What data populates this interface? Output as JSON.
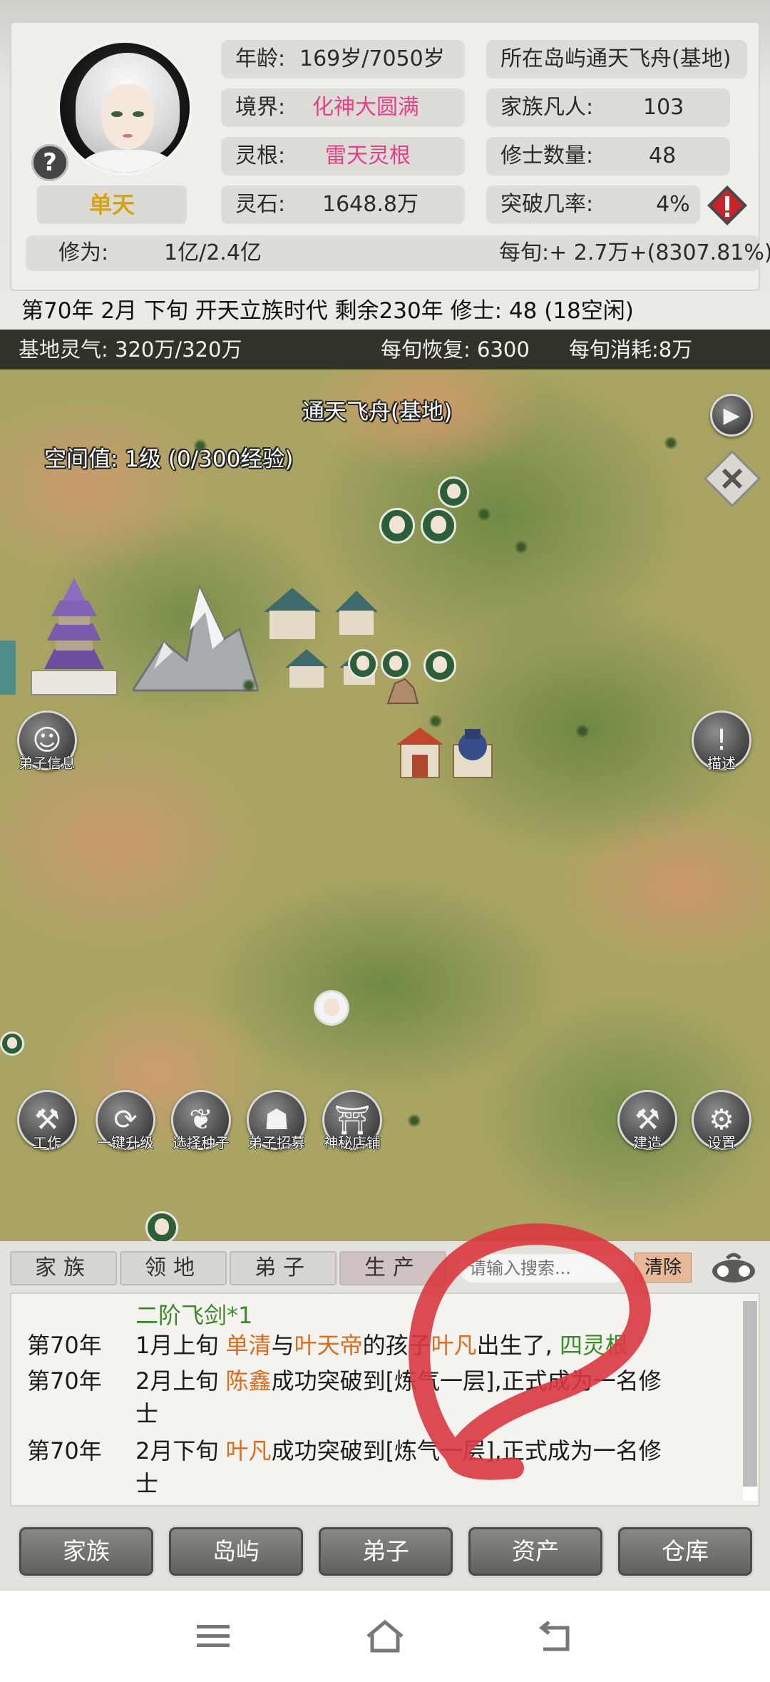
{
  "status": {
    "age_label": "年龄:",
    "age_value": "169岁/7050岁",
    "realm_label": "境界:",
    "realm_value": "化神大圆满",
    "root_label": "灵根:",
    "root_value": "雷天灵根",
    "stone_label": "灵石:",
    "stone_value": "1648.8万",
    "island_text": "所在岛屿通天飞舟(基地)",
    "mortals_label": "家族凡人:",
    "mortals_value": "103",
    "cultivators_label": "修士数量:",
    "cultivators_value": "48",
    "breakthrough_label": "突破几率:",
    "breakthrough_value": "4%",
    "cultivation_label": "修为:",
    "cultivation_value": "1亿/2.4亿",
    "per_period": "每旬:+ 2.7万+(8307.81%)",
    "character_name": "单天"
  },
  "timeline": "第70年 2月 下旬  开天立族时代 剩余230年 修士: 48 (18空闲)",
  "map": {
    "energy": "基地灵气: 320万/320万",
    "recovery": "每旬恢复: 6300",
    "consumption": "每旬消耗:8万",
    "location_title": "通天飞舟(基地)",
    "space_value": "空间值: 1级 (0/300经验)",
    "buttons": {
      "disciple_info": "弟子信息",
      "describe": "描述",
      "work": "工作",
      "upgrade": "一键升级",
      "seeds": "选择种子",
      "recruit": "弟子招募",
      "shop": "神秘店铺",
      "build": "建造",
      "settings": "设置"
    }
  },
  "tabs": [
    "家族",
    "领地",
    "弟子",
    "生产"
  ],
  "search": {
    "placeholder": "请输入搜索..."
  },
  "clear_label": "清除",
  "log": {
    "line0": "二阶飞剑*1",
    "e1_year": "第70年",
    "e1_time": "1月上旬",
    "e1_name1": "单清",
    "e1_mid1": "与",
    "e1_name2": "叶天帝",
    "e1_mid2": "的孩子",
    "e1_name3": "叶凡",
    "e1_mid3": "出生了,",
    "e1_root": "四灵根",
    "e2_year": "第70年",
    "e2_time": "2月上旬",
    "e2_name": "陈鑫",
    "e2_text": "成功突破到[炼气一层],正式成为一名修",
    "e2_cont": "士",
    "e3_year": "第70年",
    "e3_time": "2月下旬",
    "e3_name": "叶凡",
    "e3_text": "成功突破到[炼气一层],正式成为一名修",
    "e3_cont": "士"
  },
  "nav": [
    "家族",
    "岛屿",
    "弟子",
    "资产",
    "仓库"
  ],
  "colors": {
    "realm": "#e2418a",
    "name": "#d96b1c",
    "root": "#3a8a2a",
    "annotation": "#d9393f"
  }
}
